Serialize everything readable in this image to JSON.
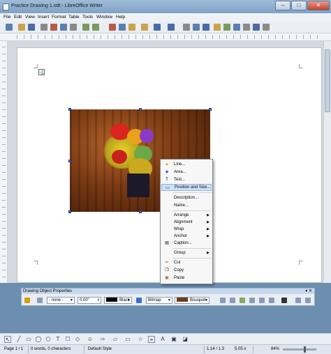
{
  "window": {
    "title": "Practice Drawing 1.odt - LibreOffice Writer",
    "minimize": "–",
    "maximize": "□",
    "close": "✕"
  },
  "menu": [
    "File",
    "Edit",
    "View",
    "Insert",
    "Format",
    "Table",
    "Tools",
    "Window",
    "Help"
  ],
  "context_menu": {
    "items": [
      {
        "label": "Line...",
        "icon": "line-icon"
      },
      {
        "label": "Area...",
        "icon": "area-icon"
      },
      {
        "label": "Text...",
        "icon": "text-icon"
      },
      {
        "label": "Position and Size...",
        "icon": "position-size-icon",
        "highlighted": true
      },
      {
        "label": "Description...",
        "icon": ""
      },
      {
        "label": "Name...",
        "icon": ""
      },
      {
        "label": "Arrange",
        "submenu": true
      },
      {
        "label": "Alignment",
        "submenu": true
      },
      {
        "label": "Wrap",
        "submenu": true
      },
      {
        "label": "Anchor",
        "submenu": true
      },
      {
        "label": "Caption...",
        "icon": "caption-icon"
      },
      {
        "label": "Group",
        "submenu": true
      },
      {
        "label": "Cut",
        "icon": "cut-icon"
      },
      {
        "label": "Copy",
        "icon": "copy-icon"
      },
      {
        "label": "Paste",
        "icon": "paste-icon"
      }
    ]
  },
  "drawing_object_properties": {
    "title": "Drawing Object Properties",
    "arrow_style": "- none -",
    "line_width": "0.00\"",
    "line_color": {
      "label": "Black",
      "color": "#000000"
    },
    "area_style": "Bitmap",
    "area_fill": {
      "label": "Bouquet",
      "color": "#6b3a1c"
    }
  },
  "status": {
    "page": "Page 1 / 1",
    "words": "0 words, 0 characters",
    "style": "Default Style",
    "position": "1.14 / 1.3",
    "size": "5.05 x",
    "zoom": "84%"
  },
  "colors": {
    "accent": "#3a6fd0",
    "menu_highlight": "#cfe1f6"
  }
}
